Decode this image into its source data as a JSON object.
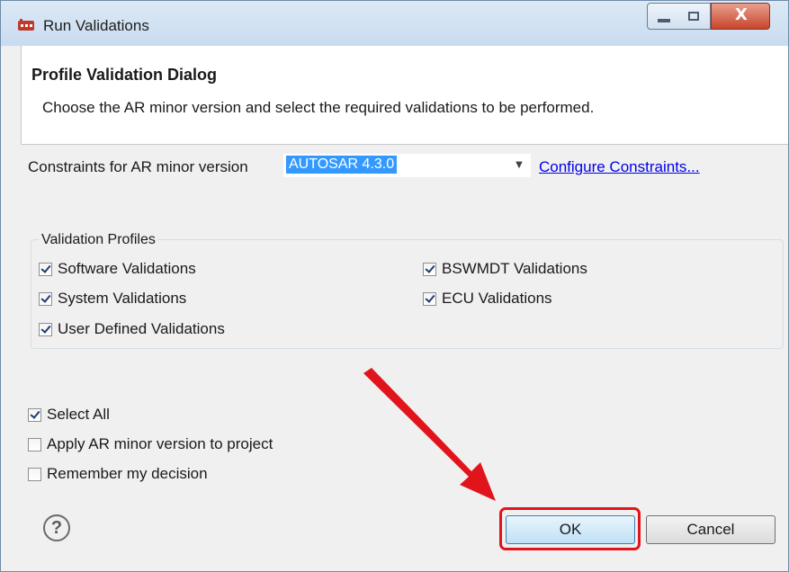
{
  "window": {
    "title": "Run Validations",
    "close_glyph": "X",
    "accent_close": "#c9452b"
  },
  "header": {
    "title": "Profile Validation Dialog",
    "description": "Choose the AR minor version and select the required validations to be performed."
  },
  "constraints": {
    "label": "Constraints for AR minor version",
    "selected_value": "AUTOSAR 4.3.0",
    "configure_link": "Configure Constraints..."
  },
  "profiles": {
    "legend": "Validation Profiles",
    "items": [
      {
        "label": "Software Validations",
        "checked": true
      },
      {
        "label": "System Validations",
        "checked": true
      },
      {
        "label": "User Defined Validations",
        "checked": true
      },
      {
        "label": "BSWMDT Validations",
        "checked": true
      },
      {
        "label": "ECU Validations",
        "checked": true
      }
    ]
  },
  "options": {
    "select_all": {
      "label": "Select All",
      "checked": true
    },
    "apply_version": {
      "label": "Apply AR minor version to project",
      "checked": false
    },
    "remember": {
      "label": "Remember my decision",
      "checked": false
    }
  },
  "footer": {
    "help_glyph": "?",
    "ok_label": "OK",
    "cancel_label": "Cancel"
  },
  "annotation": {
    "highlight_color": "#e1141c",
    "arrow_color": "#e1141c",
    "arrow_icon": "red-arrow-icon"
  }
}
